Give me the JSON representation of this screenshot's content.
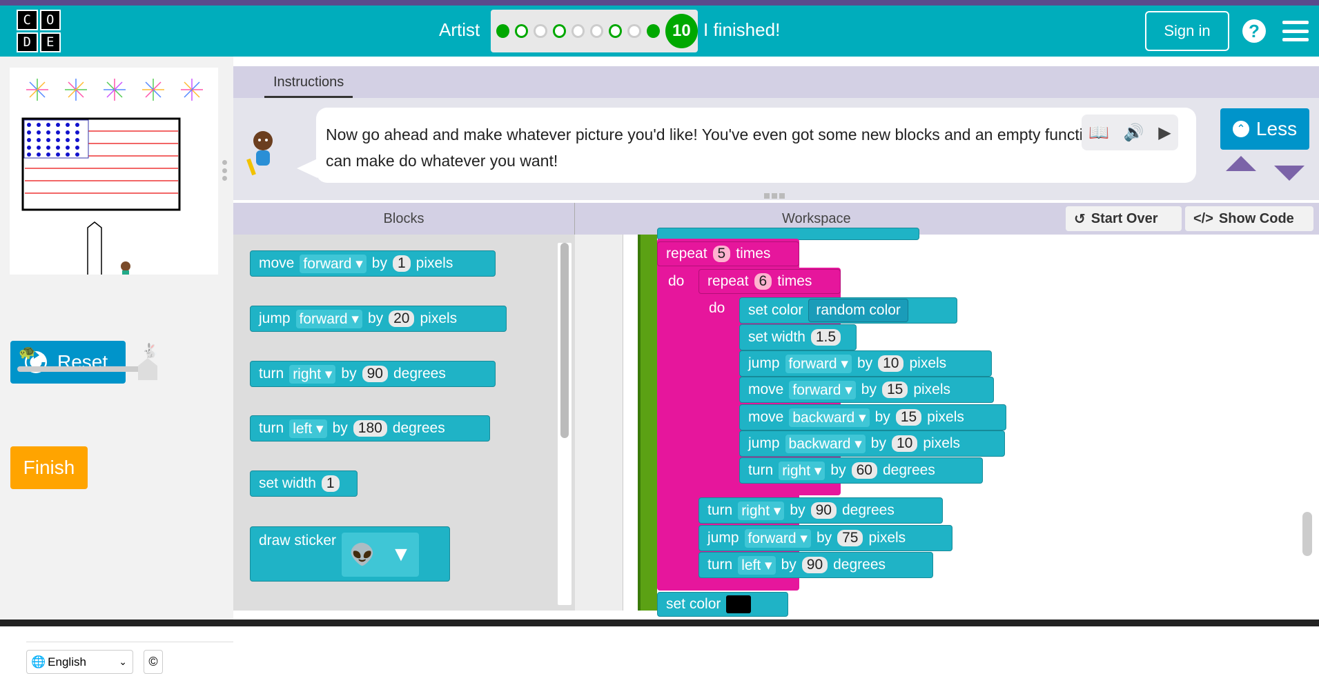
{
  "logo": {
    "letters": [
      "C",
      "O",
      "D",
      "E"
    ]
  },
  "header": {
    "level_title": "Artist",
    "current_level": "10",
    "finished_label": "I finished!",
    "signin_label": "Sign in",
    "help_label": "?"
  },
  "left": {
    "reset_label": "Reset",
    "finish_label": "Finish",
    "language": "English",
    "copyright": "©"
  },
  "instructions": {
    "tab_label": "Instructions",
    "text": "Now go ahead and make whatever picture you'd like! You've even got some new blocks and an empty function that you can make do whatever you want!",
    "less_label": "Less"
  },
  "blocks_panel": {
    "title": "Blocks",
    "items": [
      {
        "kind": "move",
        "parts": [
          "move",
          "forward ▾",
          "by",
          "1",
          "pixels"
        ]
      },
      {
        "kind": "jump",
        "parts": [
          "jump",
          "forward ▾",
          "by",
          "20",
          "pixels"
        ]
      },
      {
        "kind": "turn",
        "parts": [
          "turn",
          "right ▾",
          "by",
          "90",
          "degrees"
        ]
      },
      {
        "kind": "turn",
        "parts": [
          "turn",
          "left ▾",
          "by",
          "180",
          "degrees"
        ]
      },
      {
        "kind": "width",
        "parts": [
          "set width",
          "1"
        ]
      },
      {
        "kind": "sticker",
        "parts": [
          "draw sticker"
        ]
      }
    ]
  },
  "workspace": {
    "title": "Workspace",
    "start_over_label": "Start Over",
    "show_code_label": "Show Code",
    "outer_repeat": {
      "label": "repeat",
      "count": "5",
      "suffix": "times",
      "do": "do"
    },
    "inner_repeat": {
      "label": "repeat",
      "count": "6",
      "suffix": "times",
      "do": "do"
    },
    "inner_blocks": [
      {
        "a": "set color",
        "b": "",
        "c": "random color"
      },
      {
        "a": "set width",
        "n": "1.5"
      },
      {
        "a": "jump",
        "f": "forward ▾",
        "b": "by",
        "n": "10",
        "c": "pixels"
      },
      {
        "a": "move",
        "f": "forward ▾",
        "b": "by",
        "n": "15",
        "c": "pixels"
      },
      {
        "a": "move",
        "f": "backward ▾",
        "b": "by",
        "n": "15",
        "c": "pixels"
      },
      {
        "a": "jump",
        "f": "backward ▾",
        "b": "by",
        "n": "10",
        "c": "pixels"
      },
      {
        "a": "turn",
        "f": "right ▾",
        "b": "by",
        "n": "60",
        "c": "degrees"
      }
    ],
    "outer_blocks": [
      {
        "a": "turn",
        "f": "right ▾",
        "b": "by",
        "n": "90",
        "c": "degrees"
      },
      {
        "a": "jump",
        "f": "forward ▾",
        "b": "by",
        "n": "75",
        "c": "pixels"
      },
      {
        "a": "turn",
        "f": "left ▾",
        "b": "by",
        "n": "90",
        "c": "degrees"
      }
    ],
    "last_block": "set color"
  }
}
